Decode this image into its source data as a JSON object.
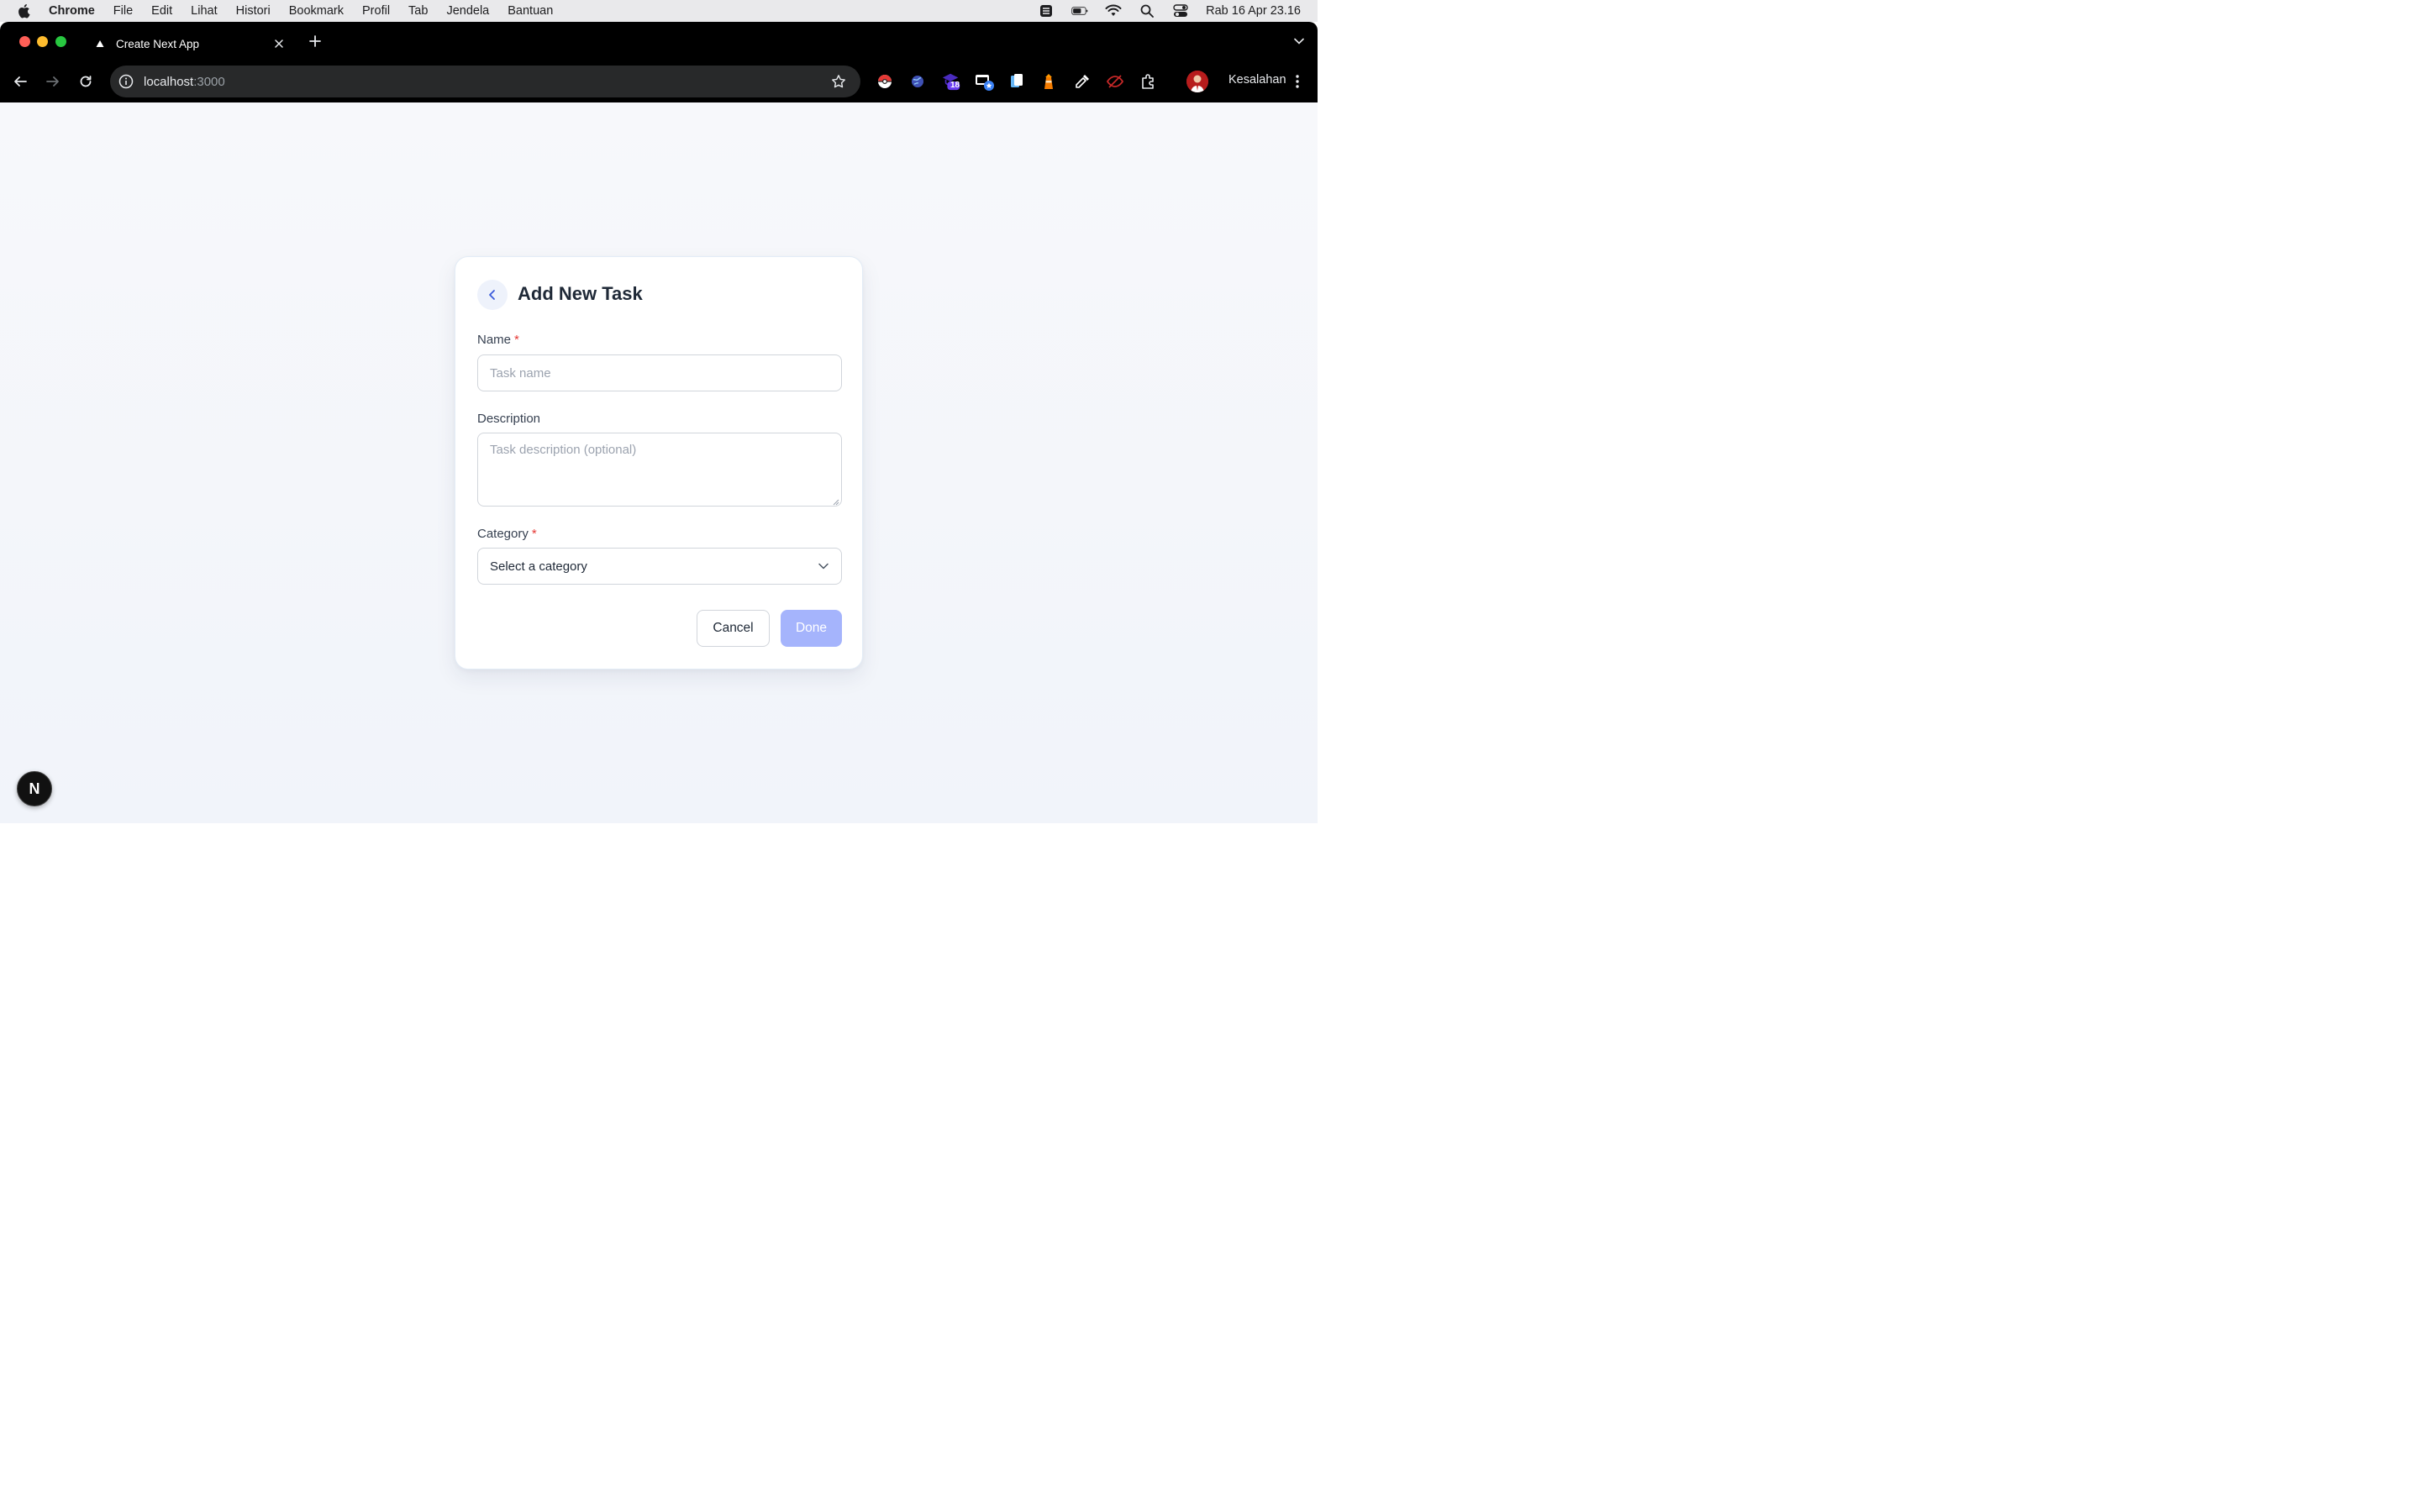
{
  "menubar": {
    "app_name": "Chrome",
    "items": [
      "File",
      "Edit",
      "Lihat",
      "Histori",
      "Bookmark",
      "Profil",
      "Tab",
      "Jendela",
      "Bantuan"
    ],
    "clock": "Rab 16 Apr  23.16"
  },
  "browser": {
    "tab_title": "Create Next App",
    "url_host": "localhost",
    "url_port": ":3000",
    "profile_name": "Kesalahan",
    "extension_badge": "18"
  },
  "form": {
    "title": "Add New Task",
    "name_label": "Name",
    "name_required": "*",
    "name_placeholder": "Task name",
    "description_label": "Description",
    "description_placeholder": "Task description (optional)",
    "category_label": "Category",
    "category_required": "*",
    "category_value": "Select a category",
    "cancel_label": "Cancel",
    "done_label": "Done"
  },
  "dev_badge": "N",
  "colors": {
    "accent_soft": "#a5b4fc",
    "required": "#e53935",
    "back_bg": "#eef2fb"
  }
}
